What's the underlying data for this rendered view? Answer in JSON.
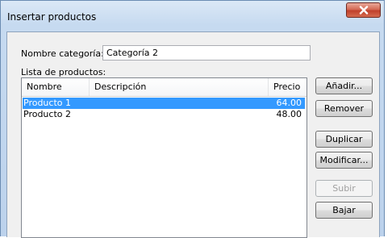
{
  "window": {
    "title": "Insertar productos"
  },
  "form": {
    "category_label": "Nombre categoría:",
    "category_value": "Categoría 2",
    "list_label": "Lista de productos:"
  },
  "list": {
    "columns": [
      "Nombre",
      "Descripción",
      "Precio"
    ],
    "rows": [
      {
        "nombre": "Producto 1",
        "descripcion": "",
        "precio": "64.00",
        "selected": true
      },
      {
        "nombre": "Producto 2",
        "descripcion": "",
        "precio": "48.00",
        "selected": false
      }
    ]
  },
  "buttons": {
    "add": "Añadir...",
    "remove": "Remover",
    "duplicate": "Duplicar",
    "modify": "Modificar...",
    "up": "Subir",
    "down": "Bajar"
  },
  "colors": {
    "selection": "#3399ff",
    "close_button": "#c7432d"
  },
  "icons": {
    "close": "close-icon"
  }
}
